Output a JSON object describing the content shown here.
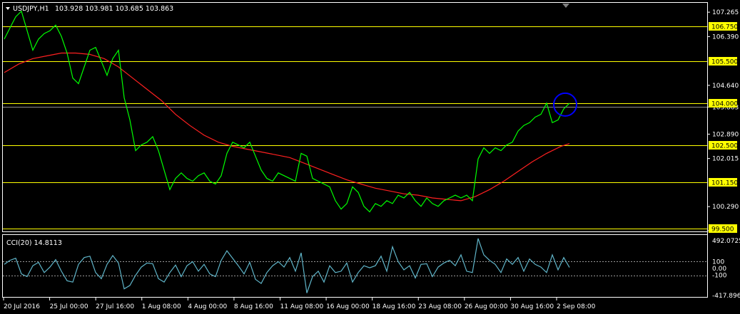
{
  "window": {
    "symbol_title": "USDJPY,H1",
    "ohlc": "103.928 103.981 103.685 103.863"
  },
  "indicator": {
    "title": "CCI(20) 14.8113",
    "scale_labels": [
      "492.0725",
      "100",
      "0.00",
      "-100",
      "-417.8967"
    ]
  },
  "chart_data": [
    {
      "type": "line",
      "title": "USDJPY,H1 103.928 103.981 103.685 103.863",
      "x_tick_labels": [
        "20 Jul 2016",
        "25 Jul 00:00",
        "27 Jul 16:00",
        "1 Aug 08:00",
        "4 Aug 00:00",
        "8 Aug 16:00",
        "11 Aug 08:00",
        "16 Aug 00:00",
        "18 Aug 16:00",
        "23 Aug 08:00",
        "26 Aug 00:00",
        "30 Aug 16:00",
        "2 Sep 08:00"
      ],
      "y_tick_labels": [
        "107.265",
        "106.390",
        "104.640",
        "103.863",
        "102.890",
        "102.015",
        "100.290",
        "99.425"
      ],
      "ylim": [
        99.4,
        107.6
      ],
      "grid": false,
      "horizontal_levels": [
        106.75,
        105.5,
        104.0,
        102.5,
        101.15,
        99.5
      ],
      "horizontal_level_labels": [
        "106.750",
        "105.500",
        "104.000",
        "102.500",
        "101.150",
        "99.500"
      ],
      "current_price": 103.863,
      "series": [
        {
          "role": "price",
          "color": "#00ff00",
          "x": [
            0,
            8,
            16,
            24,
            32,
            40,
            48,
            56,
            64,
            72,
            80,
            88,
            96,
            104,
            112,
            120,
            128,
            136,
            144,
            152,
            160,
            168,
            176,
            184,
            192,
            200,
            208,
            216,
            224,
            232,
            240,
            248,
            256,
            264,
            272,
            280,
            288,
            296,
            304,
            312,
            320,
            328,
            336,
            344,
            352,
            360,
            368,
            376,
            384,
            392,
            400,
            408,
            416,
            424,
            432,
            440,
            448,
            456,
            464,
            472,
            480,
            488,
            496,
            504,
            512,
            520,
            528,
            536,
            544,
            552,
            560,
            568,
            576,
            584,
            592,
            600,
            608,
            616,
            624,
            632,
            640,
            648,
            656,
            664,
            672,
            680,
            688,
            696,
            704,
            712,
            720,
            728,
            736,
            744,
            752,
            760,
            768,
            776,
            784,
            792
          ],
          "values": [
            106.3,
            106.7,
            107.1,
            107.3,
            106.6,
            105.9,
            106.3,
            106.5,
            106.6,
            106.8,
            106.4,
            105.8,
            104.9,
            104.7,
            105.3,
            105.9,
            106.0,
            105.5,
            105.0,
            105.6,
            105.9,
            104.2,
            103.4,
            102.3,
            102.5,
            102.6,
            102.8,
            102.3,
            101.6,
            100.9,
            101.3,
            101.5,
            101.3,
            101.2,
            101.4,
            101.5,
            101.2,
            101.1,
            101.4,
            102.2,
            102.6,
            102.5,
            102.4,
            102.6,
            102.1,
            101.6,
            101.3,
            101.2,
            101.5,
            101.4,
            101.3,
            101.2,
            102.2,
            102.1,
            101.3,
            101.2,
            101.1,
            101.0,
            100.5,
            100.2,
            100.4,
            101.0,
            100.8,
            100.3,
            100.1,
            100.4,
            100.3,
            100.5,
            100.4,
            100.7,
            100.6,
            100.8,
            100.5,
            100.3,
            100.6,
            100.4,
            100.3,
            100.5,
            100.6,
            100.7,
            100.6,
            100.7,
            100.5,
            102.0,
            102.4,
            102.2,
            102.4,
            102.3,
            102.5,
            102.6,
            103.0,
            103.2,
            103.3,
            103.5,
            103.6,
            104.0,
            103.3,
            103.4,
            103.8,
            104.0
          ]
        },
        {
          "role": "moving_average",
          "color": "#ff2020",
          "x": [
            0,
            20,
            40,
            60,
            80,
            100,
            120,
            140,
            160,
            180,
            200,
            220,
            240,
            260,
            280,
            300,
            320,
            340,
            360,
            380,
            400,
            420,
            440,
            460,
            480,
            500,
            520,
            540,
            560,
            580,
            600,
            620,
            640,
            660,
            680,
            700,
            720,
            740,
            760,
            780,
            792
          ],
          "values": [
            105.1,
            105.4,
            105.6,
            105.7,
            105.8,
            105.8,
            105.75,
            105.6,
            105.3,
            104.9,
            104.5,
            104.1,
            103.6,
            103.2,
            102.85,
            102.6,
            102.45,
            102.35,
            102.25,
            102.15,
            102.05,
            101.85,
            101.65,
            101.45,
            101.25,
            101.1,
            100.95,
            100.85,
            100.75,
            100.7,
            100.6,
            100.55,
            100.5,
            100.65,
            100.9,
            101.2,
            101.55,
            101.9,
            102.2,
            102.45,
            102.55
          ]
        }
      ],
      "marker": {
        "shape": "circle",
        "color": "#0000ff",
        "x": 786,
        "value": 103.95
      }
    },
    {
      "type": "line",
      "title": "CCI(20) 14.8113",
      "ylim": [
        -417.8967,
        492.0725
      ],
      "y_tick_labels": [
        "492.0725",
        "100",
        "0.00",
        "-100",
        "-417.8967"
      ],
      "levels": [
        100,
        -100
      ],
      "series": [
        {
          "role": "cci",
          "color": "#5fb4c8",
          "x": [
            0,
            8,
            16,
            24,
            32,
            40,
            48,
            56,
            64,
            72,
            80,
            88,
            96,
            104,
            112,
            120,
            128,
            136,
            144,
            152,
            160,
            168,
            176,
            184,
            192,
            200,
            208,
            216,
            224,
            232,
            240,
            248,
            256,
            264,
            272,
            280,
            288,
            296,
            304,
            312,
            320,
            328,
            336,
            344,
            352,
            360,
            368,
            376,
            384,
            392,
            400,
            408,
            416,
            424,
            432,
            440,
            448,
            456,
            464,
            472,
            480,
            488,
            496,
            504,
            512,
            520,
            528,
            536,
            544,
            552,
            560,
            568,
            576,
            584,
            592,
            600,
            608,
            616,
            624,
            632,
            640,
            648,
            656,
            664,
            672,
            680,
            688,
            696,
            704,
            712,
            720,
            728,
            736,
            744,
            752,
            760,
            768,
            776,
            784,
            792
          ],
          "values": [
            60,
            120,
            150,
            -80,
            -120,
            40,
            90,
            -60,
            20,
            130,
            -40,
            -180,
            -200,
            60,
            160,
            180,
            -60,
            -150,
            60,
            190,
            80,
            -300,
            -250,
            -100,
            20,
            80,
            70,
            -150,
            -200,
            -60,
            50,
            -120,
            40,
            100,
            -40,
            60,
            -80,
            -120,
            120,
            260,
            150,
            40,
            -80,
            90,
            -160,
            -220,
            -60,
            40,
            100,
            20,
            160,
            -40,
            230,
            -360,
            -120,
            -40,
            -200,
            40,
            -60,
            -40,
            80,
            -200,
            -60,
            40,
            10,
            40,
            180,
            -40,
            320,
            100,
            -20,
            40,
            -140,
            60,
            70,
            -120,
            20,
            80,
            120,
            40,
            200,
            -40,
            -60,
            440,
            200,
            120,
            60,
            -60,
            140,
            60,
            160,
            -40,
            140,
            60,
            20,
            -60,
            200,
            -20,
            160,
            15
          ]
        }
      ]
    }
  ]
}
